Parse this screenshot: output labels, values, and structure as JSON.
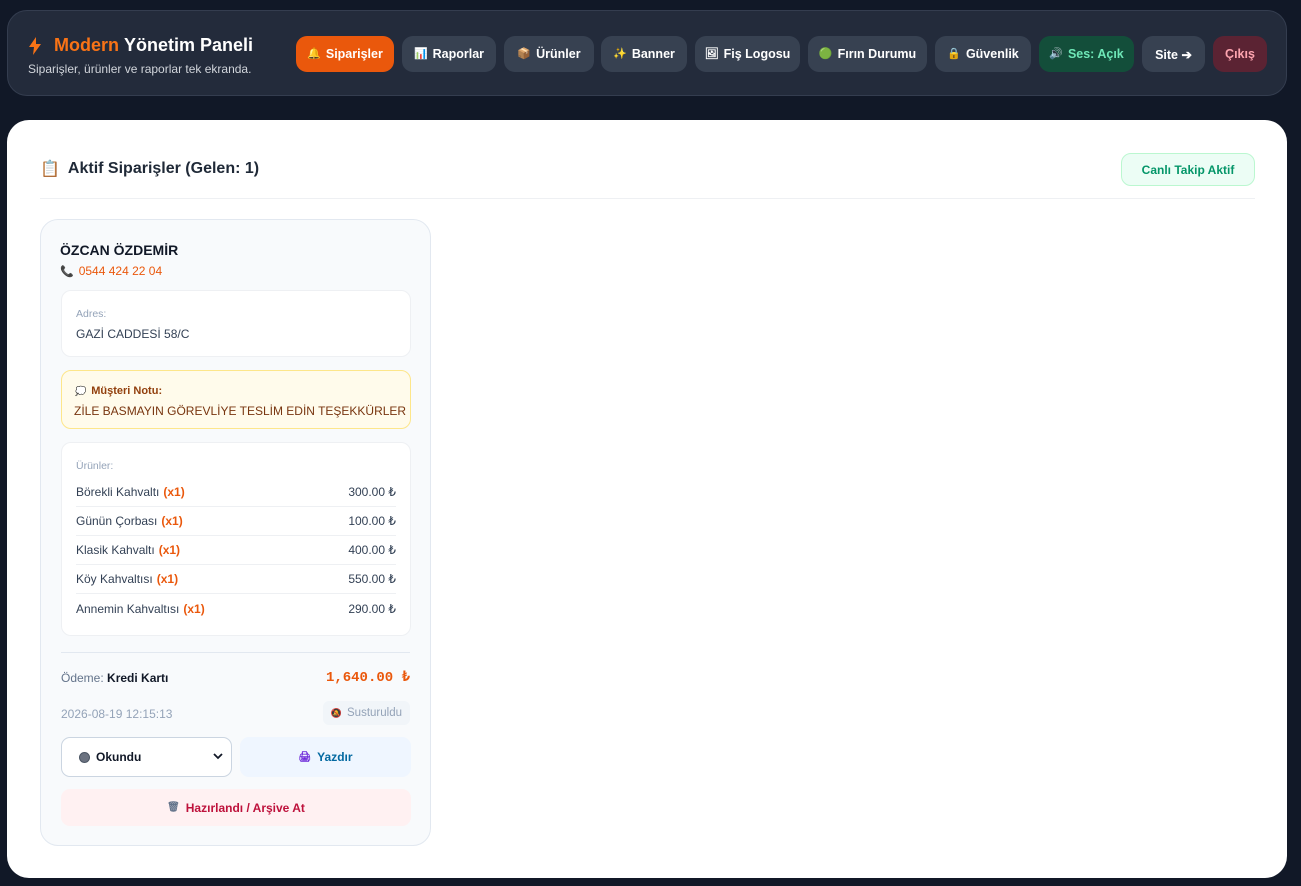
{
  "header": {
    "brand_accent": "Modern",
    "brand_rest": "Yönetim Paneli",
    "subtitle": "Siparişler, ürünler ve raporlar tek ekranda."
  },
  "nav": [
    {
      "label": "Siparişler",
      "icon": "🔔",
      "icon_name": "bell-icon",
      "active": true
    },
    {
      "label": "Raporlar",
      "icon": "📊",
      "icon_name": "chart-icon"
    },
    {
      "label": "Ürünler",
      "icon": "📦",
      "icon_name": "package-icon"
    },
    {
      "label": "Banner",
      "icon": "✨",
      "icon_name": "sparkles-icon"
    },
    {
      "label": "Fiş Logosu",
      "icon": "🖼",
      "icon_name": "image-icon"
    },
    {
      "label": "Fırın Durumu",
      "icon": "🟢",
      "icon_name": "status-dot-icon"
    },
    {
      "label": "Güvenlik",
      "icon": "🔒",
      "icon_name": "lock-icon"
    },
    {
      "label": "Ses: Açık",
      "icon": "🔊",
      "icon_name": "speaker-icon"
    },
    {
      "label": "Site ➔",
      "icon": "",
      "icon_name": ""
    },
    {
      "label": "Çıkış",
      "icon": "",
      "icon_name": ""
    }
  ],
  "panel": {
    "title": "Aktif Siparişler (Gelen: 1)",
    "title_icon": "📋",
    "live_badge": "Canlı Takip Aktif"
  },
  "order": {
    "customer_name": "ÖZCAN ÖZDEMİR",
    "phone": "0544 424 22 04",
    "address_label": "Adres:",
    "address": "GAZİ CADDESİ 58/C",
    "note_label": "Müşteri Notu:",
    "note": "ZİLE BASMAYIN GÖREVLİYE TESLİM EDİN TEŞEKKÜRLER",
    "items_label": "Ürünler:",
    "items": [
      {
        "name": "Börekli Kahvaltı",
        "qty": "(x1)",
        "price": "300.00 ₺"
      },
      {
        "name": "Günün Çorbası",
        "qty": "(x1)",
        "price": "100.00 ₺"
      },
      {
        "name": "Klasik Kahvaltı",
        "qty": "(x1)",
        "price": "400.00 ₺"
      },
      {
        "name": "Köy Kahvaltısı",
        "qty": "(x1)",
        "price": "550.00 ₺"
      },
      {
        "name": "Annemin Kahvaltısı",
        "qty": "(x1)",
        "price": "290.00 ₺"
      }
    ],
    "payment_label": "Ödeme:",
    "payment_method": "Kredi Kartı",
    "total": "1,640.00 ₺",
    "timestamp": "2026-08-19 12:15:13",
    "muted_label": "Susturuldu",
    "status_value": "Okundu",
    "print_label": "Yazdır",
    "archive_label": "Hazırlandı / Arşive At"
  },
  "colors": {
    "accent": "#ea580c",
    "background": "#111827",
    "topbar": "#232b3b"
  }
}
